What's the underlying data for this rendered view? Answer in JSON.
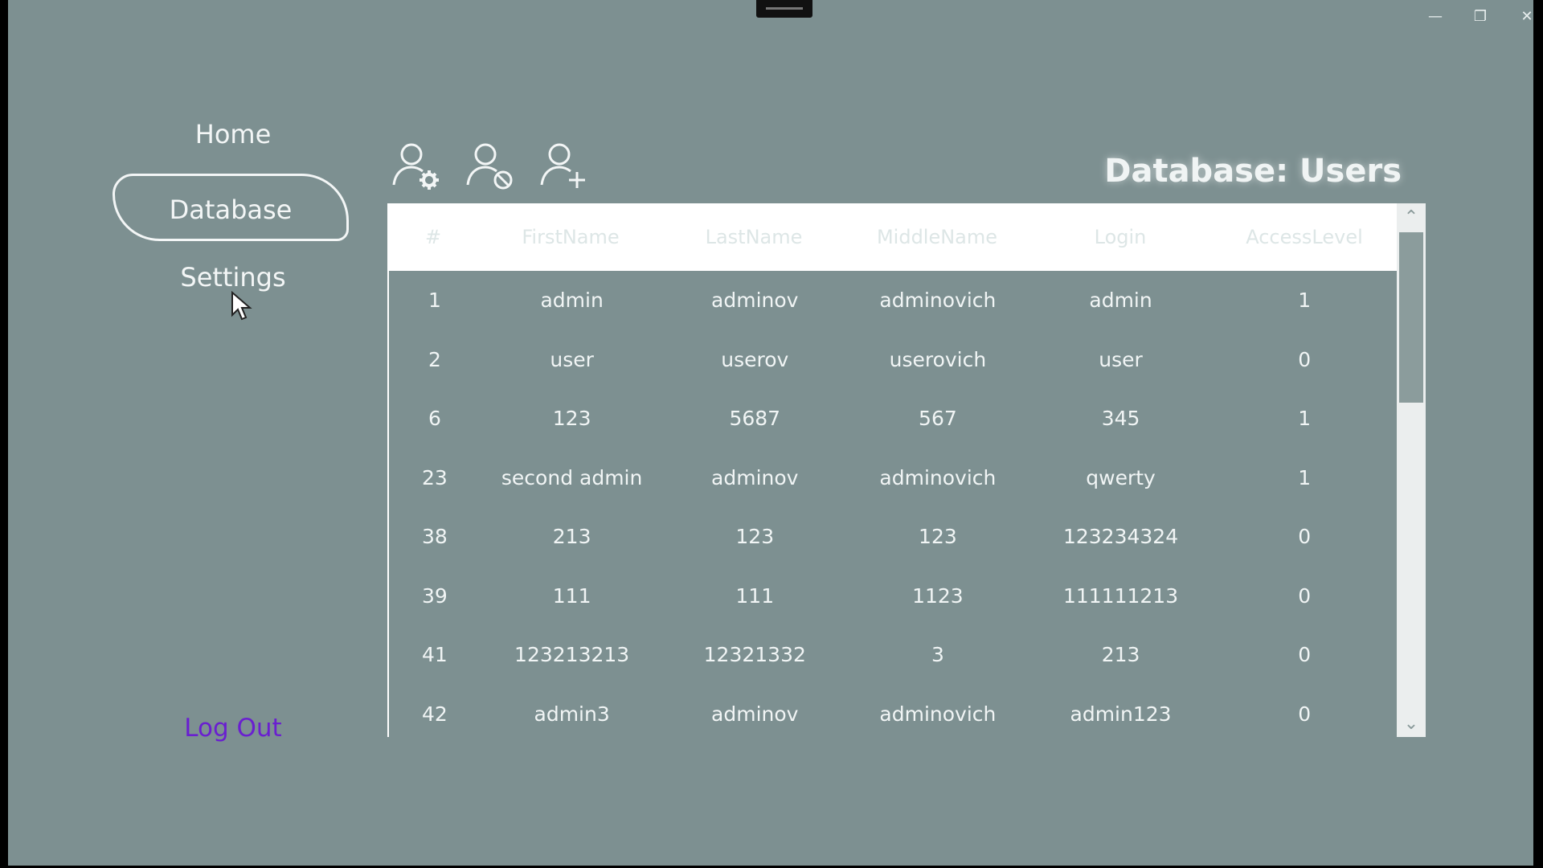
{
  "window": {
    "controls": {
      "minimize": "—",
      "maximize": "❐",
      "close": "✕"
    }
  },
  "nav": {
    "items": [
      {
        "label": "Home",
        "active": false
      },
      {
        "label": "Database",
        "active": true
      },
      {
        "label": "Settings",
        "active": false
      }
    ],
    "logout_label": "Log Out"
  },
  "toolbar": {
    "icons": [
      "user-settings-icon",
      "user-block-icon",
      "user-add-icon"
    ]
  },
  "title": "Database: Users",
  "table": {
    "columns": [
      "#",
      "FirstName",
      "LastName",
      "MiddleName",
      "Login",
      "AccessLevel"
    ],
    "rows": [
      [
        "1",
        "admin",
        "adminov",
        "adminovich",
        "admin",
        "1"
      ],
      [
        "2",
        "user",
        "userov",
        "userovich",
        "user",
        "0"
      ],
      [
        "6",
        "123",
        "5687",
        "567",
        "345",
        "1"
      ],
      [
        "23",
        "second admin",
        "adminov",
        "adminovich",
        "qwerty",
        "1"
      ],
      [
        "38",
        "213",
        "123",
        "123",
        "123234324",
        "0"
      ],
      [
        "39",
        "111",
        "111",
        "1123",
        "111111213",
        "0"
      ],
      [
        "41",
        "123213213",
        "12321332",
        "3",
        "213",
        "0"
      ],
      [
        "42",
        "admin3",
        "adminov",
        "adminovich",
        "admin123",
        "0"
      ]
    ]
  },
  "colors": {
    "background": "#7d9091",
    "logout": "#6a1fd0",
    "header_bg": "#ffffff"
  }
}
